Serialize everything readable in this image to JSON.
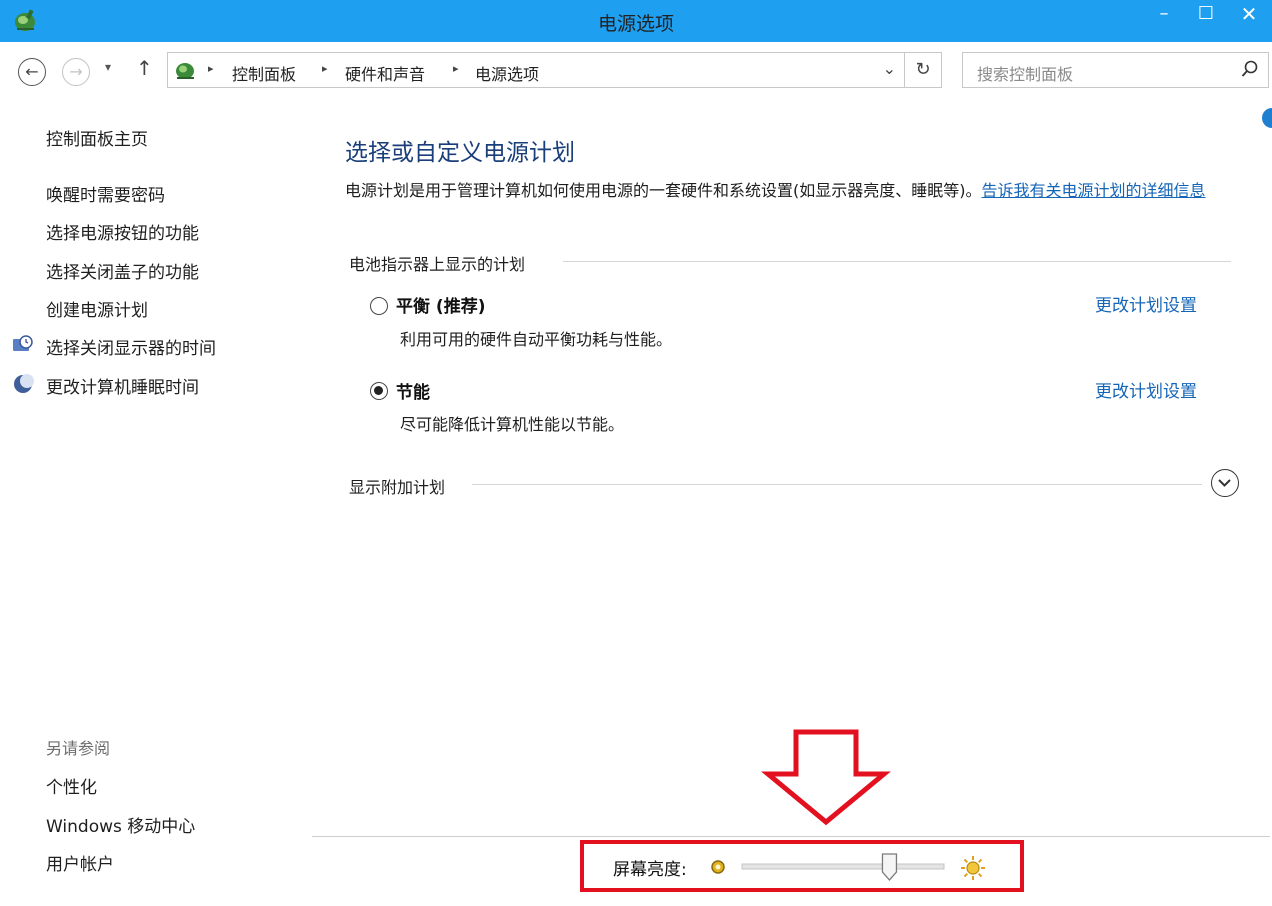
{
  "window": {
    "title": "电源选项",
    "minimize_glyph": "–",
    "maximize_glyph": "☐",
    "close_glyph": "✕"
  },
  "nav": {
    "back_glyph": "←",
    "forward_glyph": "→",
    "recent_glyph": "▾",
    "up_glyph": "↑",
    "dropdown_glyph": "⌄",
    "refresh_glyph": "↻",
    "breadcrumbs": [
      "控制面板",
      "硬件和声音",
      "电源选项"
    ],
    "search_placeholder": "搜索控制面板"
  },
  "sidebar": {
    "home": "控制面板主页",
    "links": [
      "唤醒时需要密码",
      "选择电源按钮的功能",
      "选择关闭盖子的功能",
      "创建电源计划",
      "选择关闭显示器的时间",
      "更改计算机睡眠时间"
    ],
    "see_also_label": "另请参阅",
    "see_also": [
      "个性化",
      "Windows 移动中心",
      "用户帐户"
    ]
  },
  "main": {
    "title": "选择或自定义电源计划",
    "description": "电源计划是用于管理计算机如何使用电源的一套硬件和系统设置(如显示器亮度、睡眠等)。",
    "description_link": "告诉我有关电源计划的详细信息",
    "battery_section": "电池指示器上显示的计划",
    "plans": [
      {
        "name": "平衡 (推荐)",
        "desc": "利用可用的硬件自动平衡功耗与性能。",
        "change": "更改计划设置",
        "selected": false
      },
      {
        "name": "节能",
        "desc": "尽可能降低计算机性能以节能。",
        "change": "更改计划设置",
        "selected": true
      }
    ],
    "more_plans": "显示附加计划"
  },
  "brightness": {
    "label": "屏幕亮度:",
    "level_fraction": 0.73
  },
  "colors": {
    "titlebar": "#1e9ff0",
    "link": "#1565b7",
    "heading": "#1a3e7a",
    "highlight": "#e3101f"
  }
}
